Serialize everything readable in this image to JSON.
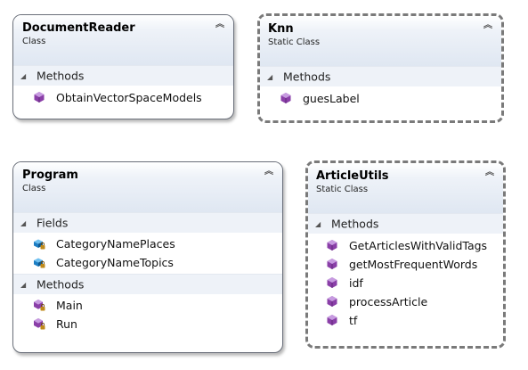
{
  "diagram": {
    "shapes": [
      {
        "id": "documentreader",
        "name": "DocumentReader",
        "stereotype": "Class",
        "style": "solid",
        "compartments": [
          {
            "label": "Methods",
            "members": [
              {
                "name": "ObtainVectorSpaceModels",
                "icon": "method-icon"
              }
            ]
          }
        ]
      },
      {
        "id": "knn",
        "name": "Knn",
        "stereotype": "Static Class",
        "style": "dashed",
        "compartments": [
          {
            "label": "Methods",
            "members": [
              {
                "name": "guesLabel",
                "icon": "method-icon"
              }
            ]
          }
        ]
      },
      {
        "id": "program",
        "name": "Program",
        "stereotype": "Class",
        "style": "solid",
        "compartments": [
          {
            "label": "Fields",
            "members": [
              {
                "name": "CategoryNamePlaces",
                "icon": "private-field-icon"
              },
              {
                "name": "CategoryNameTopics",
                "icon": "private-field-icon"
              }
            ]
          },
          {
            "label": "Methods",
            "members": [
              {
                "name": "Main",
                "icon": "private-method-icon"
              },
              {
                "name": "Run",
                "icon": "private-method-icon"
              }
            ]
          }
        ]
      },
      {
        "id": "articleutils",
        "name": "ArticleUtils",
        "stereotype": "Static Class",
        "style": "dashed",
        "compartments": [
          {
            "label": "Methods",
            "members": [
              {
                "name": "GetArticlesWithValidTags",
                "icon": "method-icon"
              },
              {
                "name": "getMostFrequentWords",
                "icon": "method-icon"
              },
              {
                "name": "idf",
                "icon": "method-icon"
              },
              {
                "name": "processArticle",
                "icon": "method-icon"
              },
              {
                "name": "tf",
                "icon": "method-icon"
              }
            ]
          }
        ]
      }
    ],
    "colors": {
      "method_icon": "#8a3fa8",
      "field_icon": "#1c7ec4",
      "lock": "#c08a1a"
    }
  }
}
